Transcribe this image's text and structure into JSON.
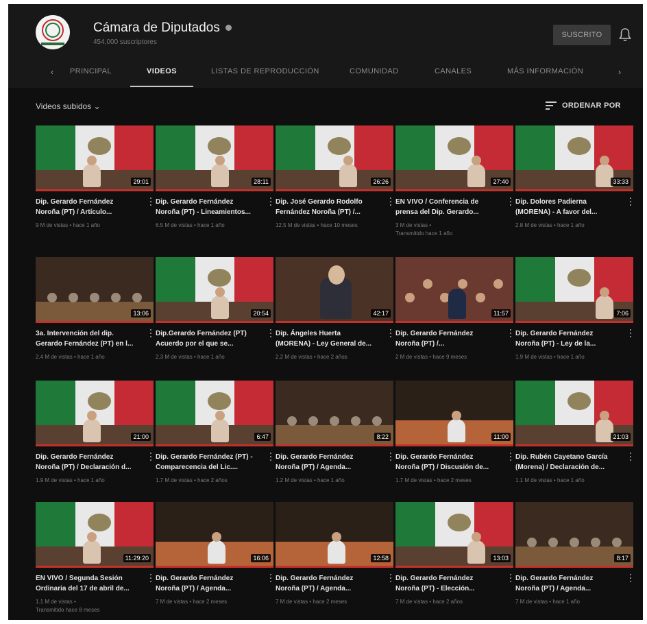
{
  "channel": {
    "title": "Cámara de Diputados",
    "subscribers": "454,000 suscriptores",
    "subscribe_label": "SUSCRITO"
  },
  "tabs": [
    {
      "label": "PRINCIPAL"
    },
    {
      "label": "VIDEOS"
    },
    {
      "label": "LISTAS DE REPRODUCCIÓN"
    },
    {
      "label": "COMUNIDAD"
    },
    {
      "label": "CANALES"
    },
    {
      "label": "MÁS INFORMACIÓN"
    }
  ],
  "section": {
    "title": "Videos subidos ⌄",
    "sort_label": "ORDENAR POR"
  },
  "videos": [
    {
      "title1": "Dip. Gerardo Fernández",
      "title2": "Noroña (PT) / Artículo...",
      "meta1": "9 M de vistas • hace 1 año",
      "meta2": "",
      "duration": "29:01"
    },
    {
      "title1": "Dip. Gerardo Fernández",
      "title2": "Noroña (PT) - Lineamientos...",
      "meta1": "6.5 M de vistas • hace 1 año",
      "meta2": "",
      "duration": "28:11"
    },
    {
      "title1": "Dip. José Gerardo Rodolfo",
      "title2": "Fernández Noroña (PT) /...",
      "meta1": "12.5 M de vistas • hace 10 meses",
      "meta2": "",
      "duration": "26:26"
    },
    {
      "title1": "EN VIVO / Conferencia de",
      "title2": "prensa del Dip. Gerardo...",
      "meta1": "3 M de vistas •",
      "meta2": "Transmitido hace 1 año",
      "duration": "27:40"
    },
    {
      "title1": "Dip. Dolores Padierna",
      "title2": "(MORENA) - A favor del...",
      "meta1": "2.8 M de vistas • hace 1 año",
      "meta2": "",
      "duration": "33:33"
    },
    {
      "title1": "3a. Intervención del dip.",
      "title2": "Gerardo Fernández (PT) en l...",
      "meta1": "2.4 M de vistas • hace 1 año",
      "meta2": "",
      "duration": "13:06"
    },
    {
      "title1": "Dip.Gerardo Fernández (PT)",
      "title2": "Acuerdo por el que se...",
      "meta1": "2.3 M de vistas • hace 1 año",
      "meta2": "",
      "duration": "20:54"
    },
    {
      "title1": "Dip. Ángeles Huerta",
      "title2": "(MORENA) - Ley General de...",
      "meta1": "2.2 M de vistas • hace 2 años",
      "meta2": "",
      "duration": "42:17"
    },
    {
      "title1": "Dip. Gerardo Fernández",
      "title2": "Noroña (PT) /...",
      "meta1": "2 M de vistas • hace 9 meses",
      "meta2": "",
      "duration": "11:57"
    },
    {
      "title1": "Dip. Gerardo Fernández",
      "title2": "Noroña (PT) - Ley de la...",
      "meta1": "1.9 M de vistas • hace 1 año",
      "meta2": "",
      "duration": "7:06"
    },
    {
      "title1": "Dip. Gerardo Fernández",
      "title2": "Noroña (PT) / Declaración d...",
      "meta1": "1.9 M de vistas • hace 1 año",
      "meta2": "",
      "duration": "21:00"
    },
    {
      "title1": "Dip. Gerardo Fernández (PT) -",
      "title2": "Comparecencia del Lic....",
      "meta1": "1.7 M de vistas • hace 2 años",
      "meta2": "",
      "duration": "6:47"
    },
    {
      "title1": "Dip. Gerardo Fernández",
      "title2": "Noroña (PT) / Agenda...",
      "meta1": "1.2 M de vistas • hace 1 año",
      "meta2": "",
      "duration": "8:22"
    },
    {
      "title1": "Dip. Gerardo Fernández",
      "title2": "Noroña (PT) / Discusión de...",
      "meta1": "1.7 M de vistas • hace 2 meses",
      "meta2": "",
      "duration": "11:00"
    },
    {
      "title1": "Dip. Rubén Cayetano García",
      "title2": "(Morena) / Declaración de...",
      "meta1": "1.1 M de vistas • hace 1 año",
      "meta2": "",
      "duration": "21:03"
    },
    {
      "title1": "EN VIVO / Segunda Sesión",
      "title2": "Ordinaria del 17 de abril de...",
      "meta1": "1.1 M de vistas •",
      "meta2": "Transmitido hace 8 meses",
      "duration": "11:29:20"
    },
    {
      "title1": "Dip. Gerardo Fernández",
      "title2": "Noroña (PT) / Agenda...",
      "meta1": "7 M de vistas • hace 2 meses",
      "meta2": "",
      "duration": "16:06"
    },
    {
      "title1": "Dip. Gerardo Fernández",
      "title2": "Noroña (PT) / Agenda...",
      "meta1": "7 M de vistas • hace 2 meses",
      "meta2": "",
      "duration": "12:58"
    },
    {
      "title1": "Dip. Gerardo Fernández",
      "title2": "Noroña (PT) - Elección...",
      "meta1": "7 M de vistas • hace 2 años",
      "meta2": "",
      "duration": "13:03"
    },
    {
      "title1": "Dip. Gerardo Fernández",
      "title2": "Noroña (PT) / Agenda...",
      "meta1": "7 M de vistas • hace 1 año",
      "meta2": "",
      "duration": "8:17"
    }
  ]
}
